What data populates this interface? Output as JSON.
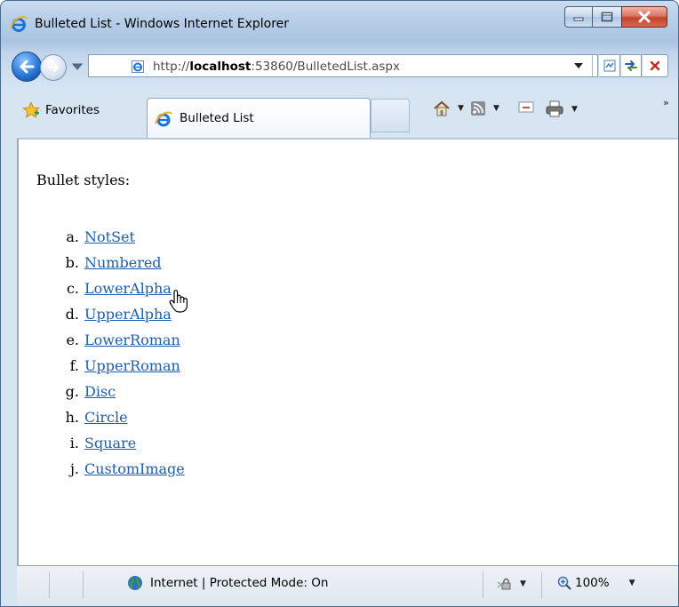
{
  "window": {
    "title": "Bulleted List - Windows Internet Explorer",
    "minimize_glyph": "—",
    "maximize_glyph": "□",
    "close_glyph": "X"
  },
  "address_bar": {
    "url_prefix": "http://",
    "url_host": "localhost",
    "url_rest": ":53860/BulletedList.aspx"
  },
  "tabs": {
    "favorites_label": "Favorites",
    "active_tab_label": "Bulleted List"
  },
  "page": {
    "heading": "Bullet styles:",
    "items": [
      {
        "marker": "a.",
        "label": "NotSet"
      },
      {
        "marker": "b.",
        "label": "Numbered"
      },
      {
        "marker": "c.",
        "label": "LowerAlpha"
      },
      {
        "marker": "d.",
        "label": "UpperAlpha"
      },
      {
        "marker": "e.",
        "label": "LowerRoman"
      },
      {
        "marker": "f.",
        "label": "UpperRoman"
      },
      {
        "marker": "g.",
        "label": "Disc"
      },
      {
        "marker": "h.",
        "label": "Circle"
      },
      {
        "marker": "i.",
        "label": "Square"
      },
      {
        "marker": "j.",
        "label": "CustomImage"
      }
    ]
  },
  "status_bar": {
    "zone_text": "Internet | Protected Mode: On",
    "zoom_text": "100%"
  },
  "colors": {
    "link": "#1a5fb4",
    "frame": "#d7e5f3",
    "close_button": "#c4422b"
  },
  "icons": [
    "ie-logo-icon",
    "back-arrow-icon",
    "forward-arrow-icon",
    "page-icon",
    "compat-view-icon",
    "refresh-icon",
    "stop-icon",
    "favorites-star-icon",
    "home-icon",
    "feeds-icon",
    "mail-icon",
    "print-icon",
    "globe-icon",
    "protected-mode-icon",
    "zoom-icon",
    "hand-cursor-icon"
  ]
}
